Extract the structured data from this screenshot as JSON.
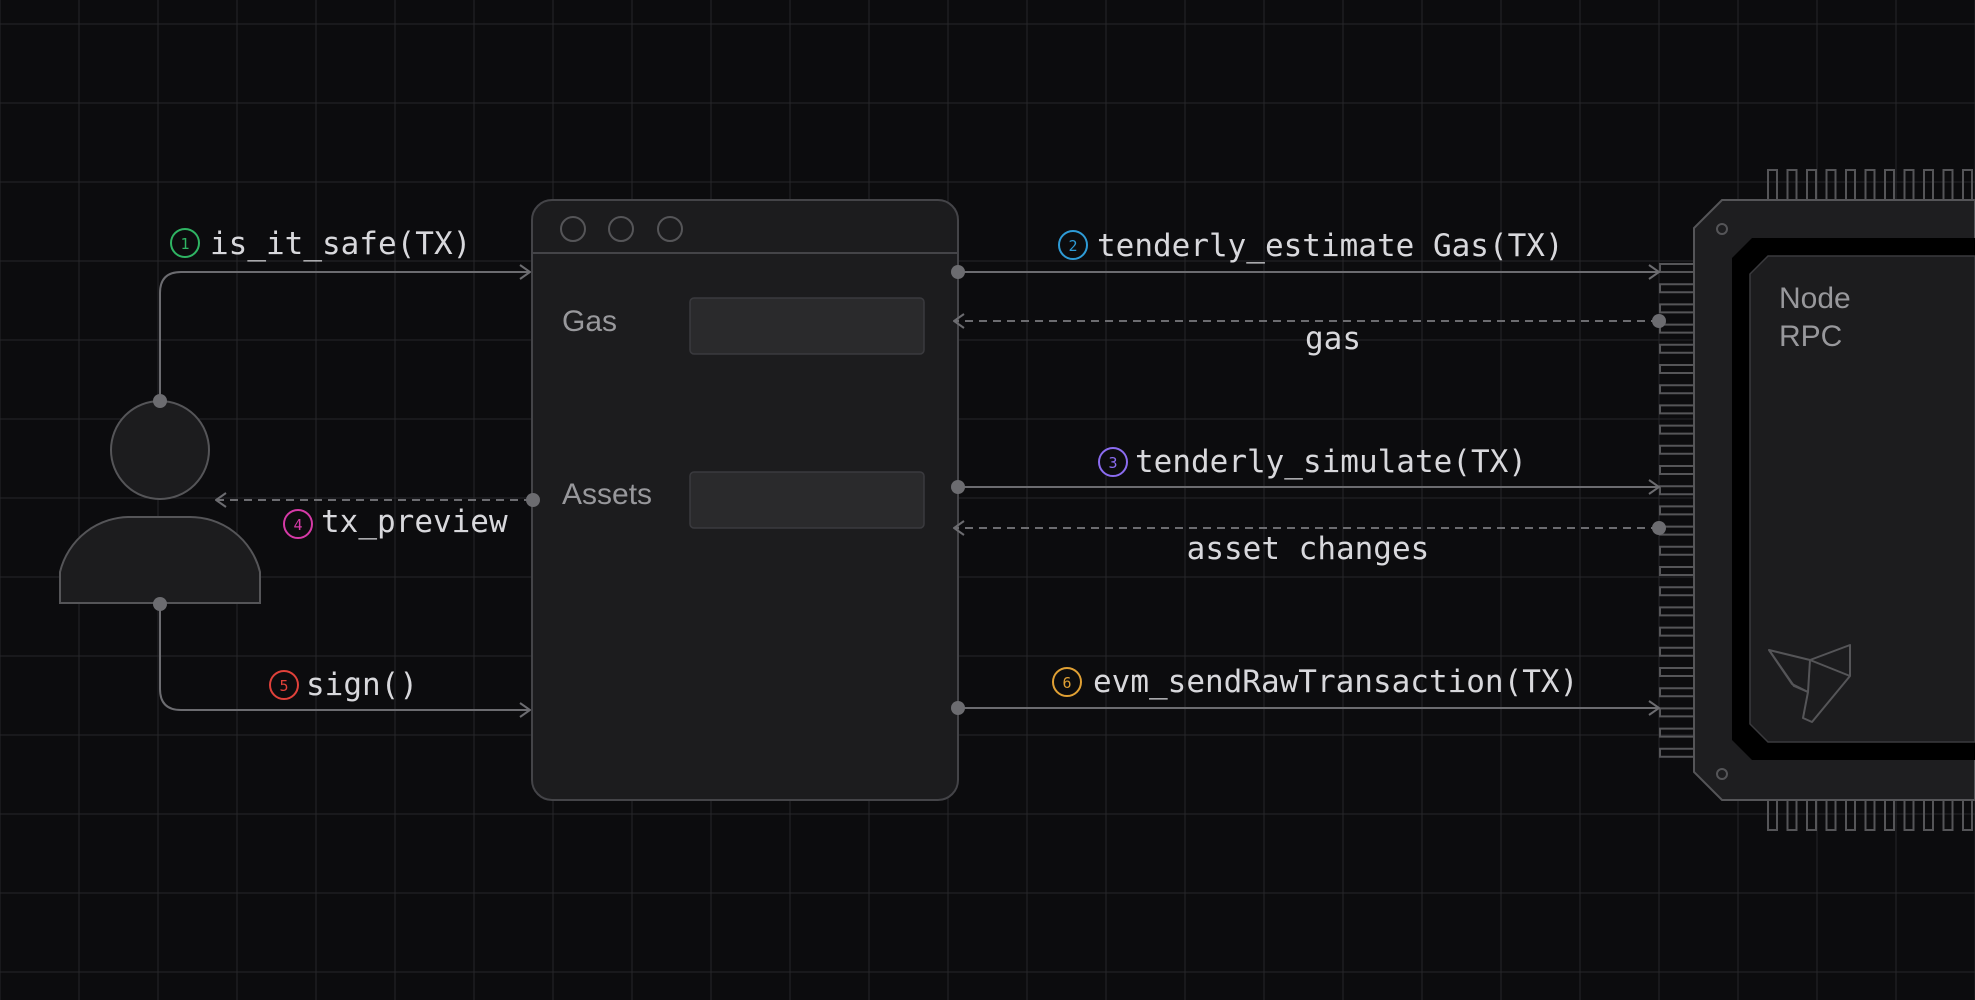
{
  "colors": {
    "background": "#0c0c0e",
    "grid": "#26262a",
    "panel": "#1c1c1e",
    "stroke": "#555558",
    "text": "#d8d8dc",
    "muted": "#98989c",
    "step1": "#2fb463",
    "step2": "#2e9bd6",
    "step3": "#8b6cf0",
    "step4": "#d63aa7",
    "step5": "#e0413a",
    "step6": "#e0a034"
  },
  "app_window": {
    "fields": [
      {
        "label": "Gas"
      },
      {
        "label": "Assets"
      }
    ]
  },
  "node_chip": {
    "title_line1": "Node",
    "title_line2": "RPC",
    "logo_icon": "tenderly-logo-icon"
  },
  "user": {
    "icon": "user-icon"
  },
  "steps": [
    {
      "number": "1",
      "label": "is_it_safe(TX)"
    },
    {
      "number": "2",
      "label": "tenderly_estimate Gas(TX)"
    },
    {
      "number": "3",
      "label": "tenderly_simulate(TX)"
    },
    {
      "number": "4",
      "label": "tx_preview"
    },
    {
      "number": "5",
      "label": "sign()"
    },
    {
      "number": "6",
      "label": "evm_sendRawTransaction(TX)"
    }
  ],
  "responses": [
    {
      "label": "gas"
    },
    {
      "label": "asset changes"
    }
  ]
}
